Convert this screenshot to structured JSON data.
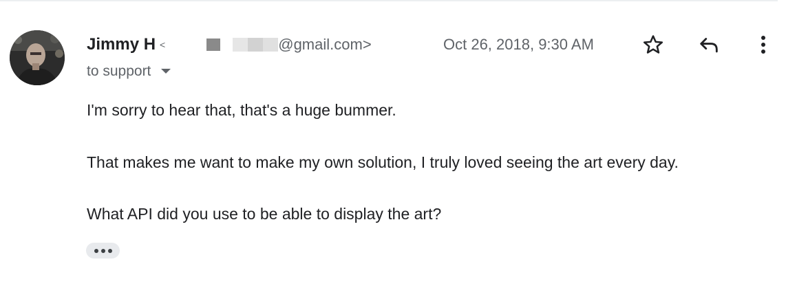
{
  "message": {
    "sender": {
      "name": "Jimmy H",
      "email_prefix_symbol": "<",
      "email_visible": "@gmail.com>",
      "avatar_icon": "user-photo-avatar"
    },
    "timestamp": "Oct 26, 2018, 9:30 AM",
    "recipient": {
      "label": "to support",
      "caret_icon": "caret-down-icon"
    },
    "actions": {
      "star_icon": "star-outline-icon",
      "reply_icon": "reply-arrow-icon",
      "more_icon": "more-vertical-icon"
    },
    "body": {
      "paragraphs": [
        "I'm sorry to hear that, that's a huge bummer.",
        "That makes me want to make my own solution, I truly loved seeing the art every day.",
        "What API did you use to be able to display the art?"
      ]
    },
    "show_trimmed_content": {
      "icon": "ellipsis-icon",
      "label": "•••"
    }
  },
  "colors": {
    "primary_text": "#202124",
    "secondary_text": "#5f6368",
    "chip_background": "#e8eaed",
    "divider": "#eceff1"
  }
}
